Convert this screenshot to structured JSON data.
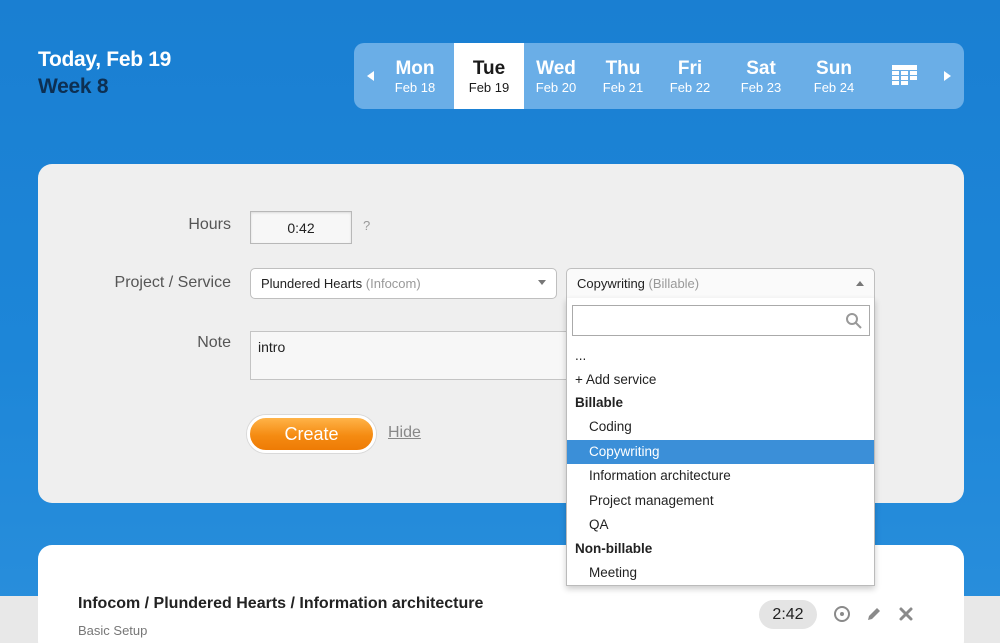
{
  "header": {
    "date_title": "Today, Feb 19",
    "week_title": "Week 8"
  },
  "week_nav": {
    "days": [
      {
        "name": "Mon",
        "date": "Feb 18"
      },
      {
        "name": "Tue",
        "date": "Feb 19"
      },
      {
        "name": "Wed",
        "date": "Feb 20"
      },
      {
        "name": "Thu",
        "date": "Feb 21"
      },
      {
        "name": "Fri",
        "date": "Feb 22"
      },
      {
        "name": "Sat",
        "date": "Feb 23"
      },
      {
        "name": "Sun",
        "date": "Feb 24"
      }
    ],
    "active_day": "Tue",
    "icons": {
      "prev": "chevron-left-icon",
      "next": "chevron-right-icon",
      "calendar": "calendar-grid-icon"
    }
  },
  "form": {
    "hours_label": "Hours",
    "hours_value": "0:42",
    "help_text": "?",
    "project_label": "Project / Service",
    "project_select": {
      "value": "Plundered Hearts",
      "client": "(Infocom)"
    },
    "service_select": {
      "value": "Copywriting",
      "type": "(Billable)"
    },
    "note_label": "Note",
    "note_value": "intro",
    "create_label": "Create",
    "hide_label": "Hide"
  },
  "dropdown": {
    "search_value": "",
    "items": [
      {
        "text": "...",
        "kind": "plain"
      },
      {
        "text": "+ Add service",
        "kind": "action"
      },
      {
        "text": "Billable",
        "kind": "group"
      },
      {
        "text": "Coding",
        "kind": "option"
      },
      {
        "text": "Copywriting",
        "kind": "option",
        "selected": true
      },
      {
        "text": "Information architecture",
        "kind": "option"
      },
      {
        "text": "Project management",
        "kind": "option"
      },
      {
        "text": "QA",
        "kind": "option"
      },
      {
        "text": "Non-billable",
        "kind": "group"
      },
      {
        "text": "Meeting",
        "kind": "option"
      }
    ]
  },
  "entry": {
    "title": "Infocom / Plundered Hearts / Information architecture",
    "subtitle": "Basic Setup",
    "time": "2:42",
    "icons": [
      "timer-icon",
      "pencil-icon",
      "delete-icon"
    ]
  },
  "colors": {
    "background": "#1d86d8",
    "accent_orange": "#f58b12",
    "selection": "#3b8fd8",
    "week_title": "#0d2f52"
  }
}
